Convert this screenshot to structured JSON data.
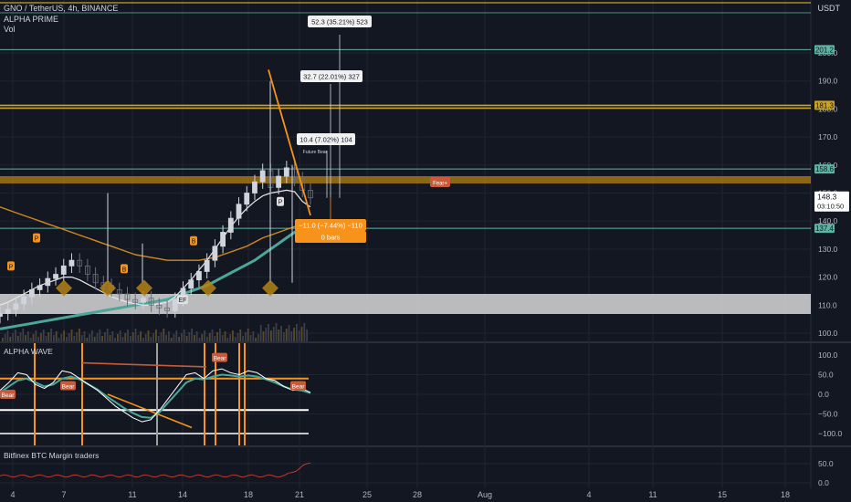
{
  "header": {
    "symbol_line": "GNO / TetherUS, 4h, BINANCE",
    "indicator_1": "ALPHA PRIME",
    "indicator_2": "Vol",
    "currency": "USDT"
  },
  "panes": {
    "oscillator_title": "ALPHA WAVE",
    "margin_title": "Bitfinex BTC Margin traders"
  },
  "colors": {
    "background": "#131722",
    "grid": "#1f2431",
    "candle_up": "#d1d4dc",
    "candle_down": "#6a6e7a",
    "orange": "#f7931a",
    "gold_line": "#c9a227",
    "teal_line": "#5fb3a4",
    "teal_ma": "#4aa79a",
    "white_ma": "#e8e8e8",
    "brown_ma": "#d08a1e",
    "bear_label": "#c75b39",
    "margin_line": "#c0392b",
    "axis_text": "#b2b5be"
  },
  "chart_data": {
    "type": "candlestick",
    "symbol": "GNO / TetherUS",
    "interval": "4h",
    "exchange": "BINANCE",
    "x_ticks": [
      "4",
      "7",
      "11",
      "14",
      "18",
      "21",
      "25",
      "28",
      "Aug",
      "4",
      "11",
      "15",
      "18"
    ],
    "y_ticks": [
      100.0,
      110.0,
      120.0,
      130.0,
      140.0,
      150.0,
      160.0,
      170.0,
      180.0,
      190.0,
      200.0
    ],
    "ylim": [
      96,
      213
    ],
    "current_price": "148.3",
    "countdown": "03:10:50",
    "levels": [
      {
        "price": 201.2,
        "label": "201.2",
        "color": "teal"
      },
      {
        "price": 181.3,
        "label": "181.3",
        "color": "gold"
      },
      {
        "price": 158.6,
        "label": "158.6",
        "color": "teal"
      },
      {
        "price": 137.4,
        "label": "137.4",
        "color": "teal"
      }
    ],
    "price_close": [
      107.0,
      108.5,
      110.5,
      113.0,
      115.5,
      117.0,
      119.5,
      121.0,
      124.0,
      126.0,
      124.0,
      121.0,
      118.0,
      117.0,
      115.5,
      114.0,
      112.0,
      111.0,
      112.5,
      110.0,
      109.0,
      108.0,
      112.0,
      116.0,
      119.0,
      122.0,
      126.0,
      131.0,
      136.0,
      141.0,
      146.0,
      150.0,
      154.0,
      158.0,
      152.0,
      156.0,
      159.0,
      155.0,
      151.0,
      148.3
    ],
    "ma_white": [
      110.0,
      111.0,
      112.5,
      114.0,
      115.5,
      117.0,
      118.0,
      119.0,
      120.0,
      120.0,
      119.0,
      117.5,
      116.0,
      114.5,
      113.0,
      112.0,
      111.0,
      110.5,
      110.0,
      110.0,
      110.5,
      111.0,
      113.0,
      116.0,
      119.0,
      122.5,
      126.0,
      130.0,
      134.0,
      138.0,
      141.5,
      144.5,
      147.0,
      149.0,
      150.0,
      150.5,
      151.0,
      150.5,
      147.0,
      145.0
    ],
    "ma_brown": [
      145.0,
      144.0,
      143.0,
      142.0,
      141.0,
      140.0,
      139.0,
      138.0,
      137.0,
      136.0,
      135.0,
      134.0,
      133.0,
      132.0,
      131.0,
      130.0,
      129.0,
      128.0,
      127.5,
      127.0,
      126.5,
      126.0,
      126.0,
      126.0,
      126.0,
      126.0,
      126.5,
      127.0,
      128.0,
      129.0,
      130.0,
      131.0,
      132.5,
      134.0,
      135.0,
      136.0,
      137.0,
      138.0,
      138.5,
      139.0
    ],
    "ma_teal": [
      101.5,
      102.0,
      102.5,
      103.0,
      103.5,
      104.0,
      104.5,
      105.0,
      105.5,
      106.0,
      106.5,
      107.0,
      107.5,
      108.0,
      108.5,
      109.0,
      109.5,
      110.0,
      110.5,
      111.0,
      111.5,
      112.0,
      113.0,
      114.0,
      115.0,
      116.0,
      117.0,
      118.5,
      120.0,
      121.5,
      123.0,
      124.5,
      126.0,
      128.0,
      130.0,
      132.0,
      134.0,
      136.0,
      138.0,
      139.5
    ],
    "annotations": [
      {
        "text": "52.3 (35.21%) 523"
      },
      {
        "text": "32.7 (22.01%) 327"
      },
      {
        "text": "10.4 (7.02%) 104"
      },
      {
        "text": "−11.0 (−7.44%) −110"
      },
      {
        "text": "0 bars"
      },
      {
        "text": "Fear+"
      },
      {
        "text": "Future Bear"
      }
    ],
    "signal_labels": [
      "P",
      "P",
      "B",
      "B",
      "P",
      "EF"
    ],
    "oscillator": {
      "title": "ALPHA WAVE",
      "y_ticks": [
        "100.0",
        "50.0",
        "0.0",
        "−50.0",
        "−100.0"
      ],
      "ylim": [
        -115,
        115
      ],
      "labels": [
        "Bear",
        "Bear",
        "Bear",
        "Bear"
      ],
      "wave_white": [
        10,
        30,
        55,
        50,
        25,
        15,
        30,
        60,
        55,
        40,
        25,
        10,
        -10,
        -30,
        -45,
        -60,
        -70,
        -65,
        -40,
        -10,
        20,
        50,
        55,
        40,
        60,
        65,
        55,
        50,
        60,
        55,
        40,
        35,
        20,
        10,
        15,
        5
      ],
      "wave_teal": [
        5,
        20,
        35,
        40,
        30,
        20,
        25,
        40,
        45,
        38,
        25,
        12,
        -5,
        -20,
        -35,
        -48,
        -58,
        -60,
        -45,
        -20,
        5,
        30,
        40,
        38,
        45,
        50,
        48,
        45,
        48,
        45,
        38,
        30,
        20,
        12,
        10,
        3
      ]
    },
    "margin_traders": {
      "title": "Bitfinex BTC Margin traders",
      "y_ticks": [
        "50.0",
        "0.0"
      ],
      "ylim": [
        -12,
        85
      ]
    }
  }
}
